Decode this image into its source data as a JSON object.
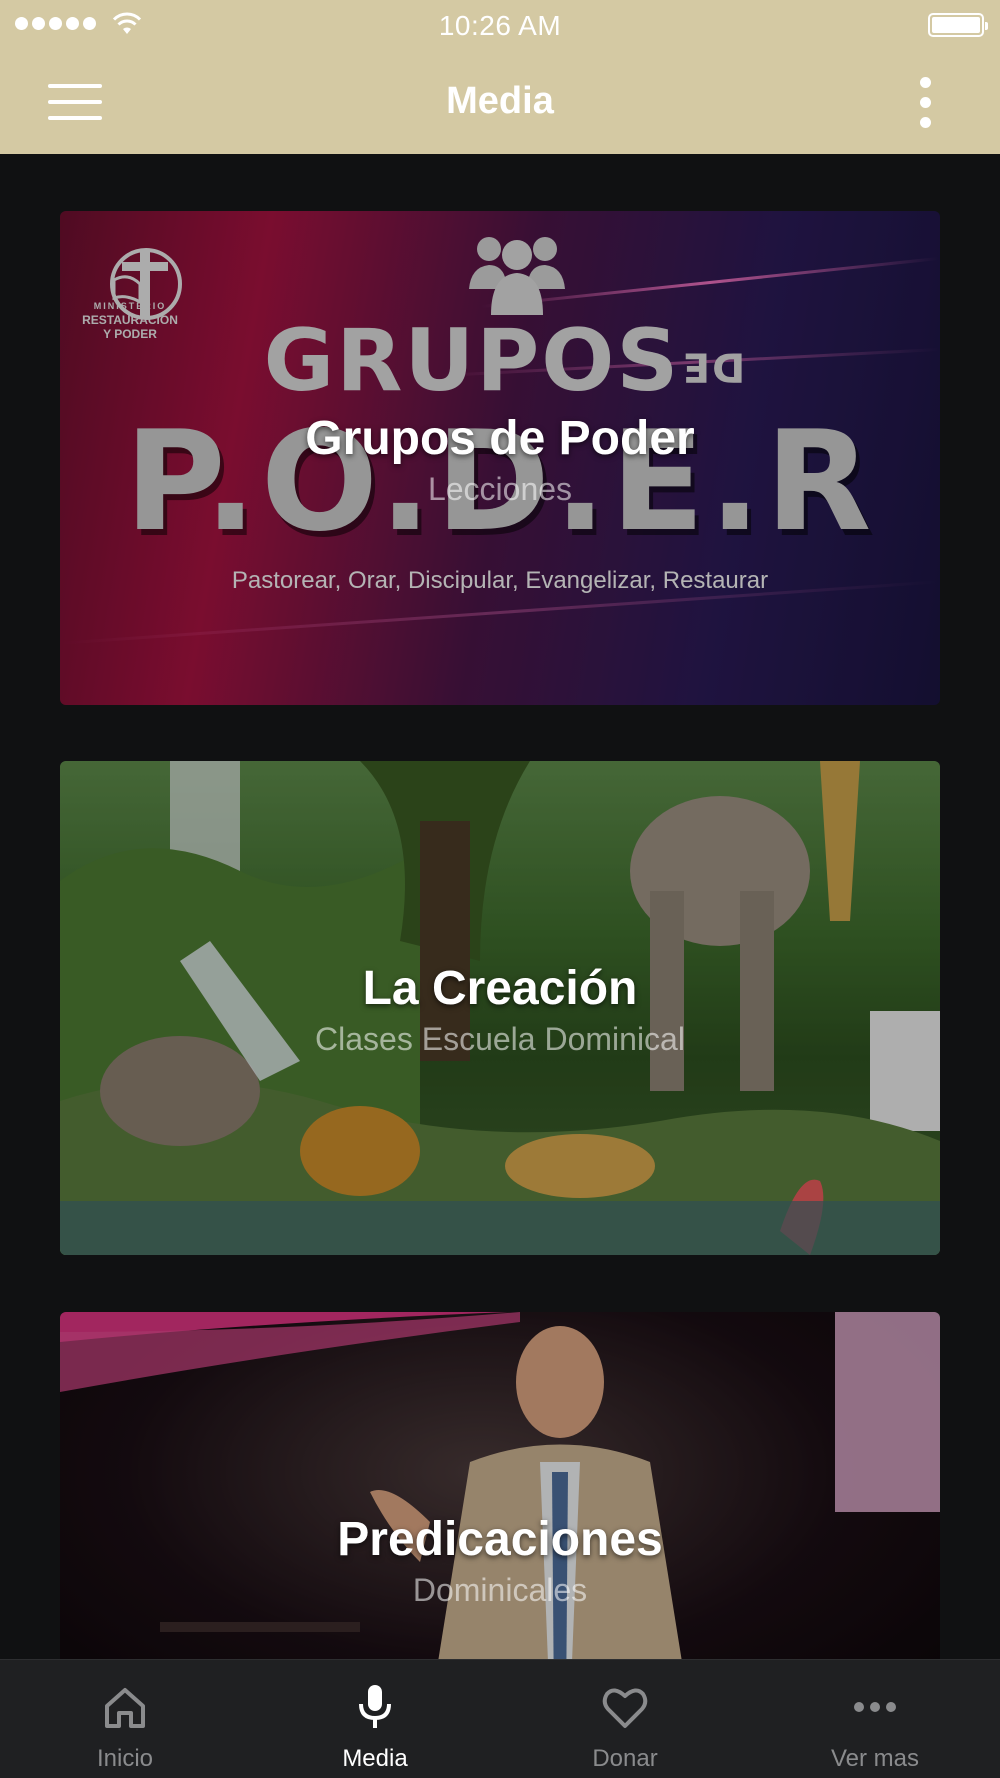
{
  "status_bar": {
    "time": "10:26 AM",
    "battery_level": 1.0
  },
  "navbar": {
    "title": "Media",
    "menu_icon": "hamburger-menu-icon",
    "more_icon": "more-vertical-icon"
  },
  "cards": [
    {
      "title": "Grupos de Poder",
      "subtitle": "Lecciones",
      "image_text": {
        "logo_line1": "MINISTERIO",
        "logo_line2": "RESTAURACION",
        "logo_line3": "Y PODER",
        "heading": "GRUPOS",
        "heading_small": "DE",
        "big": "P.O.D.E.R",
        "tagline": "Pastorear, Orar, Discipular, Evangelizar, Restaurar"
      }
    },
    {
      "title": "La Creación",
      "subtitle": "Clases Escuela Dominical"
    },
    {
      "title": "Predicaciones",
      "subtitle": "Dominicales"
    }
  ],
  "tabbar": {
    "items": [
      {
        "label": "Inicio",
        "icon": "home-icon"
      },
      {
        "label": "Media",
        "icon": "microphone-icon"
      },
      {
        "label": "Donar",
        "icon": "heart-icon"
      },
      {
        "label": "Ver mas",
        "icon": "more-horizontal-icon"
      }
    ],
    "active": "Media"
  },
  "colors": {
    "header": "#d4c9a3",
    "background": "#101112",
    "tabbar": "#1f2022",
    "tab_inactive": "#8a8b8d",
    "tab_active": "#ffffff"
  }
}
